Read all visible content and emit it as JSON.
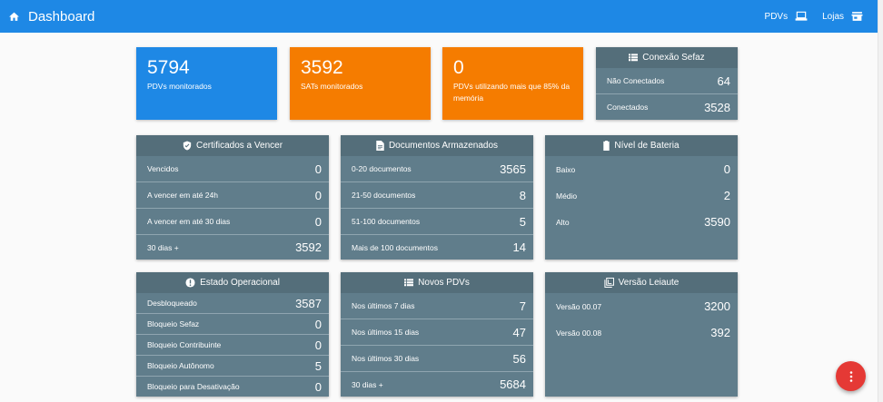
{
  "header": {
    "title": "Dashboard",
    "pdvs_label": "PDVs",
    "lojas_label": "Lojas"
  },
  "stats": [
    {
      "value": "5794",
      "label": "PDVs monitorados",
      "color": "#1e88e5"
    },
    {
      "value": "3592",
      "label": "SATs monitorados",
      "color": "#f57c00"
    },
    {
      "value": "0",
      "label": "PDVs utilizando mais que 85% da memória",
      "color": "#f57c00"
    }
  ],
  "conexao": {
    "title": "Conexão Sefaz",
    "rows": [
      {
        "label": "Não Conectados",
        "value": "64"
      },
      {
        "label": "Conectados",
        "value": "3528"
      }
    ]
  },
  "certificados": {
    "title": "Certificados a Vencer",
    "rows": [
      {
        "label": "Vencidos",
        "value": "0"
      },
      {
        "label": "A vencer em até 24h",
        "value": "0"
      },
      {
        "label": "A vencer em até 30 dias",
        "value": "0"
      },
      {
        "label": "30 dias +",
        "value": "3592"
      }
    ]
  },
  "documentos": {
    "title": "Documentos Armazenados",
    "rows": [
      {
        "label": "0-20 documentos",
        "value": "3565"
      },
      {
        "label": "21-50 documentos",
        "value": "8"
      },
      {
        "label": "51-100 documentos",
        "value": "5"
      },
      {
        "label": "Mais de 100 documentos",
        "value": "14"
      }
    ]
  },
  "bateria": {
    "title": "Nível de Bateria",
    "rows": [
      {
        "label": "Baixo",
        "value": "0"
      },
      {
        "label": "Médio",
        "value": "2"
      },
      {
        "label": "Alto",
        "value": "3590"
      }
    ]
  },
  "estado": {
    "title": "Estado Operacional",
    "rows": [
      {
        "label": "Desbloqueado",
        "value": "3587"
      },
      {
        "label": "Bloqueio Sefaz",
        "value": "0"
      },
      {
        "label": "Bloqueio Contribuinte",
        "value": "0"
      },
      {
        "label": "Bloqueio Autônomo",
        "value": "5"
      },
      {
        "label": "Bloqueio para Desativação",
        "value": "0"
      }
    ]
  },
  "novos": {
    "title": "Novos PDVs",
    "rows": [
      {
        "label": "Nos últimos 7 dias",
        "value": "7"
      },
      {
        "label": "Nos últimos 15 dias",
        "value": "47"
      },
      {
        "label": "Nos últimos 30 dias",
        "value": "56"
      },
      {
        "label": "30 dias +",
        "value": "5684"
      }
    ]
  },
  "versao": {
    "title": "Versão Leiaute",
    "rows": [
      {
        "label": "Versão 00.07",
        "value": "3200"
      },
      {
        "label": "Versão 00.08",
        "value": "392"
      }
    ]
  },
  "icons": {
    "home": "home-icon",
    "pdvs": "laptop-icon",
    "lojas": "store-icon",
    "conexao": "list-icon",
    "certificados": "shield-icon",
    "documentos": "document-icon",
    "bateria": "battery-icon",
    "estado": "alert-icon",
    "novos": "list-icon",
    "versao": "library-icon",
    "fab": "more-vert-icon"
  }
}
